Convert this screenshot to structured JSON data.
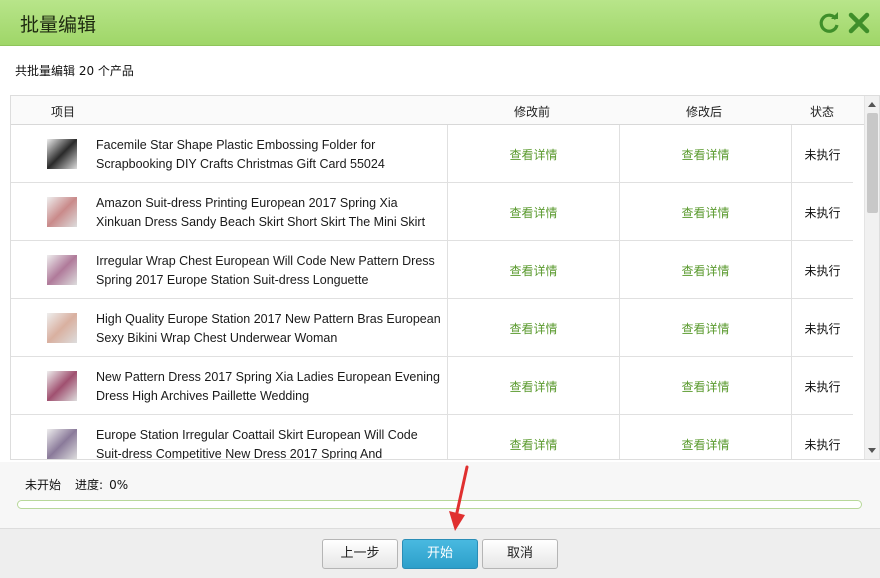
{
  "window": {
    "title": "批量编辑"
  },
  "summary": "共批量编辑 20 个产品",
  "table": {
    "headers": {
      "item": "项目",
      "before": "修改前",
      "after": "修改后",
      "status": "状态"
    },
    "rows": [
      {
        "name": "Facemile Star Shape Plastic Embossing Folder for Scrapbooking DIY Crafts Christmas Gift Card 55024",
        "before": "查看详情",
        "after": "查看详情",
        "status": "未执行",
        "thumb_color": "#2a2a2a"
      },
      {
        "name": "Amazon Suit-dress Printing European 2017 Spring Xia Xinkuan Dress Sandy Beach Skirt Short Skirt The Mini Skirt",
        "before": "查看详情",
        "after": "查看详情",
        "status": "未执行",
        "thumb_color": "#c98a8a"
      },
      {
        "name": "Irregular Wrap Chest European Will Code New Pattern Dress Spring 2017 Europe Station Suit-dress Longuette",
        "before": "查看详情",
        "after": "查看详情",
        "status": "未执行",
        "thumb_color": "#b07a9a"
      },
      {
        "name": "High Quality Europe Station 2017 New Pattern Bras European Sexy Bikini Wrap Chest Underwear Woman",
        "before": "查看详情",
        "after": "查看详情",
        "status": "未执行",
        "thumb_color": "#d9b0a0"
      },
      {
        "name": "New Pattern Dress 2017 Spring Xia Ladies European Evening Dress High Archives Paillette Wedding",
        "before": "查看详情",
        "after": "查看详情",
        "status": "未执行",
        "thumb_color": "#a05070"
      },
      {
        "name": "Europe Station Irregular Coattail Skirt European Will Code Suit-dress Competitive New Dress 2017 Spring And",
        "before": "查看详情",
        "after": "查看详情",
        "status": "未执行",
        "thumb_color": "#8a7a9a"
      }
    ]
  },
  "progress": {
    "state": "未开始",
    "label": "进度:",
    "value": "0%",
    "fraction": 0
  },
  "buttons": {
    "prev": "上一步",
    "start": "开始",
    "cancel": "取消"
  },
  "icons": {
    "refresh": "refresh-icon",
    "close": "close-icon"
  },
  "colors": {
    "accent": "#9fd668",
    "link": "#5a9a2e",
    "primary_button": "#2d9fca",
    "arrow": "#e03030"
  }
}
